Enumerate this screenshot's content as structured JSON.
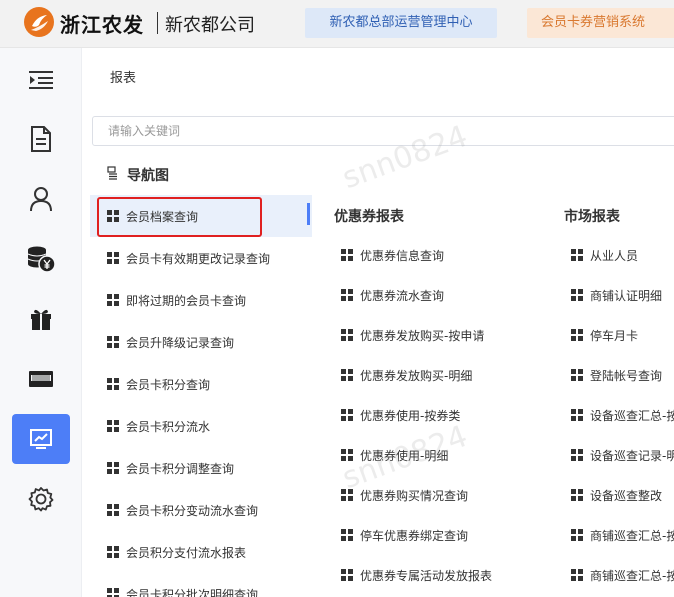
{
  "header": {
    "brand": "浙江农发",
    "company": "新农都公司",
    "tabs": [
      {
        "label": "新农都总部运营管理中心"
      },
      {
        "label": "会员卡券营销系统"
      }
    ]
  },
  "sidebar": {
    "items": [
      {
        "icon": "menu-collapse-icon"
      },
      {
        "icon": "document-icon"
      },
      {
        "icon": "user-icon"
      },
      {
        "icon": "coins-yen-icon"
      },
      {
        "icon": "gift-icon"
      },
      {
        "icon": "card-icon"
      },
      {
        "icon": "report-chart-icon",
        "active": true
      },
      {
        "icon": "gear-icon"
      }
    ]
  },
  "breadcrumb": "报表",
  "search": {
    "placeholder": "请输入关键词"
  },
  "nav_title": "导航图",
  "left_menu": [
    "会员档案查询",
    "会员卡有效期更改记录查询",
    "即将过期的会员卡查询",
    "会员升降级记录查询",
    "会员卡积分查询",
    "会员卡积分流水",
    "会员卡积分调整查询",
    "会员卡积分变动流水查询",
    "会员积分支付流水报表",
    "会员卡积分批次明细查询"
  ],
  "coupon_reports": {
    "title": "优惠券报表",
    "items": [
      "优惠券信息查询",
      "优惠券流水查询",
      "优惠券发放购买-按申请",
      "优惠券发放购买-明细",
      "优惠券使用-按券类",
      "优惠券使用-明细",
      "优惠券购买情况查询",
      "停车优惠券绑定查询",
      "优惠券专属活动发放报表"
    ]
  },
  "market_reports": {
    "title": "市场报表",
    "items": [
      "从业人员",
      "商铺认证明细",
      "停车月卡",
      "登陆帐号查询",
      "设备巡查汇总-按",
      "设备巡查记录-明",
      "设备巡查整改",
      "商铺巡查汇总-按",
      "商铺巡查汇总-按"
    ]
  },
  "watermark": "snn0824",
  "colors": {
    "accent": "#4d7ef7",
    "highlight_border": "#e02020",
    "brand_orange": "#e8741e"
  }
}
